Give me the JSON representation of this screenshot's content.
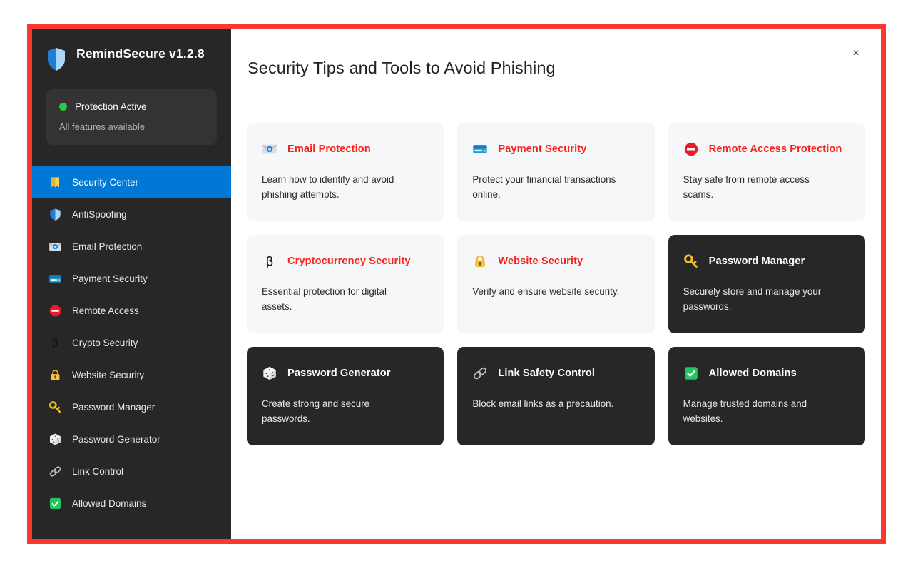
{
  "app": {
    "name": "RemindSecure",
    "version": "v1.2.8",
    "brand_line": "RemindSecure v1.2.8",
    "accent_red": "#f93832",
    "accent_blue": "#0079d6",
    "status_green": "#27c93f",
    "sidebar_bg": "#272727"
  },
  "status": {
    "title": "Protection Active",
    "subtitle": "All features available"
  },
  "sidebar": {
    "items": [
      {
        "label": "Security Center",
        "icon": "bookmark-icon",
        "active": true
      },
      {
        "label": "AntiSpoofing",
        "icon": "shield-icon",
        "active": false
      },
      {
        "label": "Email Protection",
        "icon": "email-icon",
        "active": false
      },
      {
        "label": "Payment Security",
        "icon": "credit-card-icon",
        "active": false
      },
      {
        "label": "Remote Access",
        "icon": "no-entry-icon",
        "active": false
      },
      {
        "label": "Crypto Security",
        "icon": "bitcoin-icon",
        "active": false
      },
      {
        "label": "Website Security",
        "icon": "lock-icon",
        "active": false
      },
      {
        "label": "Password Manager",
        "icon": "key-icon",
        "active": false
      },
      {
        "label": "Password Generator",
        "icon": "dice-icon",
        "active": false
      },
      {
        "label": "Link Control",
        "icon": "link-icon",
        "active": false
      },
      {
        "label": "Allowed Domains",
        "icon": "check-box-icon",
        "active": false
      }
    ]
  },
  "header": {
    "title": "Security Tips and Tools to Avoid Phishing",
    "close_label": "×"
  },
  "cards": [
    {
      "title": "Email Protection",
      "desc": "Learn how to identify and avoid phishing attempts.",
      "icon": "email-icon",
      "theme": "light"
    },
    {
      "title": "Payment Security",
      "desc": "Protect your financial transactions online.",
      "icon": "credit-card-icon",
      "theme": "light"
    },
    {
      "title": "Remote Access Protection",
      "desc": "Stay safe from remote access scams.",
      "icon": "no-entry-icon",
      "theme": "light"
    },
    {
      "title": "Cryptocurrency Security",
      "desc": "Essential protection for digital assets.",
      "icon": "bitcoin-icon",
      "theme": "light"
    },
    {
      "title": "Website Security",
      "desc": "Verify and ensure website security.",
      "icon": "lock-icon",
      "theme": "light"
    },
    {
      "title": "Password Manager",
      "desc": "Securely store and manage your passwords.",
      "icon": "key-icon",
      "theme": "dark"
    },
    {
      "title": "Password Generator",
      "desc": "Create strong and secure passwords.",
      "icon": "dice-icon",
      "theme": "dark"
    },
    {
      "title": "Link Safety Control",
      "desc": "Block email links as a precaution.",
      "icon": "link-icon",
      "theme": "dark"
    },
    {
      "title": "Allowed Domains",
      "desc": "Manage trusted domains and websites.",
      "icon": "check-box-icon",
      "theme": "dark"
    }
  ]
}
